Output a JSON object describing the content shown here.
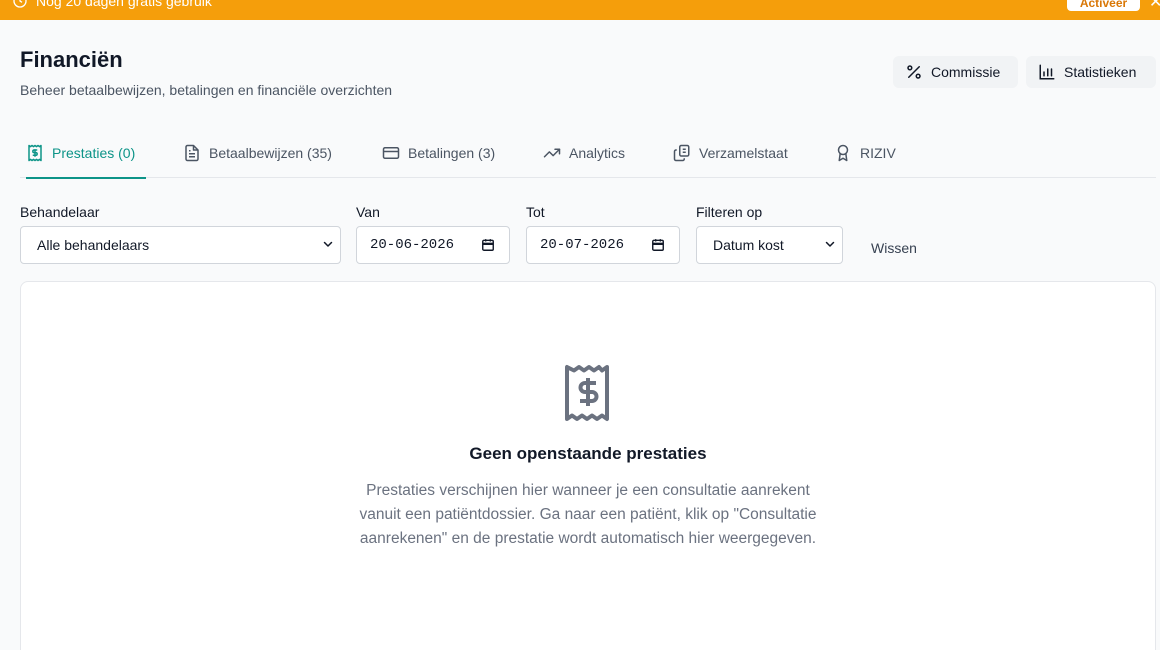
{
  "banner": {
    "message": "Nog 20 dagen gratis gebruik",
    "action_label": "Activeer",
    "close_glyph": "✕",
    "color": "#f59e0b",
    "icon": "clock-icon"
  },
  "header": {
    "title": "Financiën",
    "subtitle": "Beheer betaalbewijzen, betalingen en financiële overzichten",
    "buttons": [
      {
        "label": "Commissie",
        "icon": "percent-icon"
      },
      {
        "label": "Statistieken",
        "icon": "bar-chart-icon"
      }
    ]
  },
  "tabs": [
    {
      "label": "Prestaties (0)",
      "icon": "receipt-dollar-icon",
      "active": true
    },
    {
      "label": "Betaalbewijzen (35)",
      "icon": "document-icon",
      "active": false
    },
    {
      "label": "Betalingen (3)",
      "icon": "credit-card-icon",
      "active": false
    },
    {
      "label": "Analytics",
      "icon": "trending-up-icon",
      "active": false
    },
    {
      "label": "Verzamelstaat",
      "icon": "copy-icon",
      "active": false
    },
    {
      "label": "RIZIV",
      "icon": "award-icon",
      "active": false
    }
  ],
  "filters": {
    "practitioner": {
      "label": "Behandelaar",
      "value": "Alle behandelaars"
    },
    "from": {
      "label": "Van",
      "value": "20-06-2026"
    },
    "to": {
      "label": "Tot",
      "value": "20-07-2026"
    },
    "filter_on": {
      "label": "Filteren op",
      "value": "Datum kost"
    },
    "clear_label": "Wissen"
  },
  "empty_state": {
    "icon": "receipt-dollar-icon",
    "title": "Geen openstaande prestaties",
    "text": "Prestaties verschijnen hier wanneer je een consultatie aanrekent vanuit een patiëntdossier. Ga naar een patiënt, klik op \"Consultatie aanrekenen\" en de prestatie wordt automatisch hier weergegeven."
  },
  "colors": {
    "accent": "#0d9488",
    "banner": "#f59e0b"
  }
}
